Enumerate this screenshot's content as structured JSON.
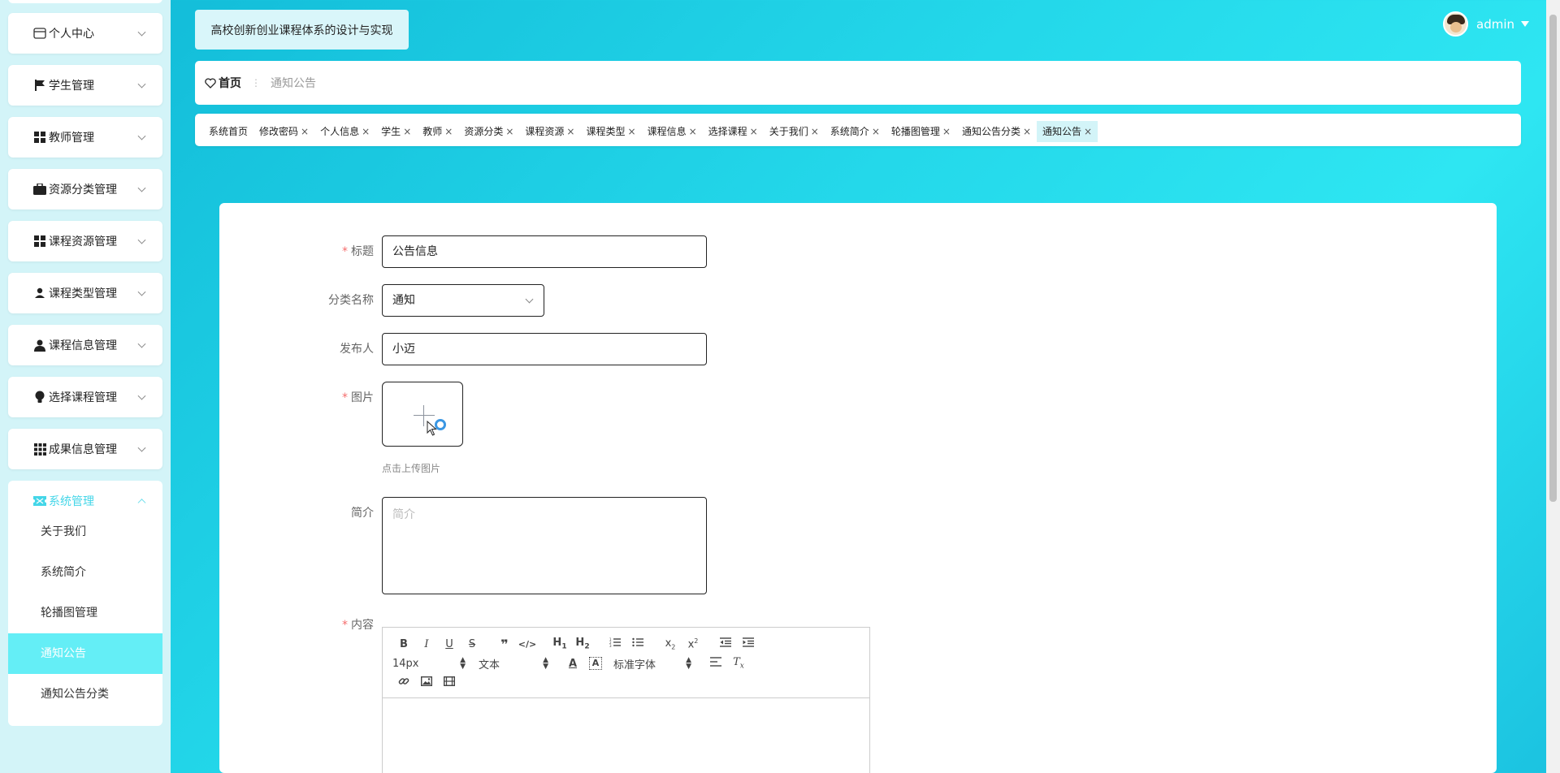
{
  "app": {
    "title": "高校创新创业课程体系的设计与实现"
  },
  "user": {
    "name": "admin"
  },
  "sidebar": {
    "items": [
      {
        "label": "个人中心",
        "icon": "card-icon"
      },
      {
        "label": "学生管理",
        "icon": "flag-icon"
      },
      {
        "label": "教师管理",
        "icon": "grid-icon"
      },
      {
        "label": "资源分类管理",
        "icon": "briefcase-icon"
      },
      {
        "label": "课程资源管理",
        "icon": "grid-icon"
      },
      {
        "label": "课程类型管理",
        "icon": "user-icon"
      },
      {
        "label": "课程信息管理",
        "icon": "person-icon"
      },
      {
        "label": "选择课程管理",
        "icon": "bulb-icon"
      },
      {
        "label": "成果信息管理",
        "icon": "apps-icon"
      },
      {
        "label": "系统管理",
        "icon": "ticket-icon"
      }
    ],
    "sub_items": [
      {
        "label": "关于我们"
      },
      {
        "label": "系统简介"
      },
      {
        "label": "轮播图管理"
      },
      {
        "label": "通知公告"
      },
      {
        "label": "通知公告分类"
      }
    ],
    "active_color": "#64eef6"
  },
  "breadcrumb": {
    "home": "首页",
    "current": "通知公告"
  },
  "tabs": [
    {
      "label": "系统首页"
    },
    {
      "label": "修改密码"
    },
    {
      "label": "个人信息"
    },
    {
      "label": "学生"
    },
    {
      "label": "教师"
    },
    {
      "label": "资源分类"
    },
    {
      "label": "课程资源"
    },
    {
      "label": "课程类型"
    },
    {
      "label": "课程信息"
    },
    {
      "label": "选择课程"
    },
    {
      "label": "关于我们"
    },
    {
      "label": "系统简介"
    },
    {
      "label": "轮播图管理"
    },
    {
      "label": "通知公告分类"
    },
    {
      "label": "通知公告"
    }
  ],
  "form": {
    "title_label": "标题",
    "title_value": "公告信息",
    "category_label": "分类名称",
    "category_value": "通知",
    "publisher_label": "发布人",
    "publisher_value": "小迈",
    "image_label": "图片",
    "image_tip": "点击上传图片",
    "intro_label": "简介",
    "intro_placeholder": "简介",
    "content_label": "内容",
    "required_mark": "*"
  },
  "editor": {
    "font_size": "14px",
    "heading": "文本",
    "font_family": "标准字体"
  }
}
